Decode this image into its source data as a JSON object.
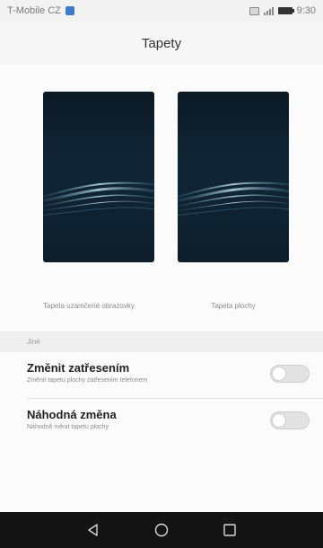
{
  "status_bar": {
    "carrier": "T-Mobile CZ",
    "time": "9:30",
    "icons": [
      "notification-icon",
      "image-icon",
      "signal-icon",
      "battery-icon"
    ]
  },
  "header": {
    "title": "Tapety"
  },
  "wallpapers": [
    {
      "label": "Tapeta uzamčené obrazovky"
    },
    {
      "label": "Tapeta plochy"
    }
  ],
  "section": {
    "title": "Jiné"
  },
  "settings": [
    {
      "title": "Změnit zatřesením",
      "subtitle": "Změnit tapetu plochy zatřesením telefonem",
      "enabled": false
    },
    {
      "title": "Náhodná změna",
      "subtitle": "Náhodně měnit tapetu plochy",
      "enabled": false
    }
  ],
  "nav": {
    "buttons": [
      "back-icon",
      "home-icon",
      "recents-icon"
    ]
  },
  "colors": {
    "accent": "#3c7bd0",
    "wallpaper_dark": "#0c1a24",
    "nav_bar": "#141414"
  }
}
